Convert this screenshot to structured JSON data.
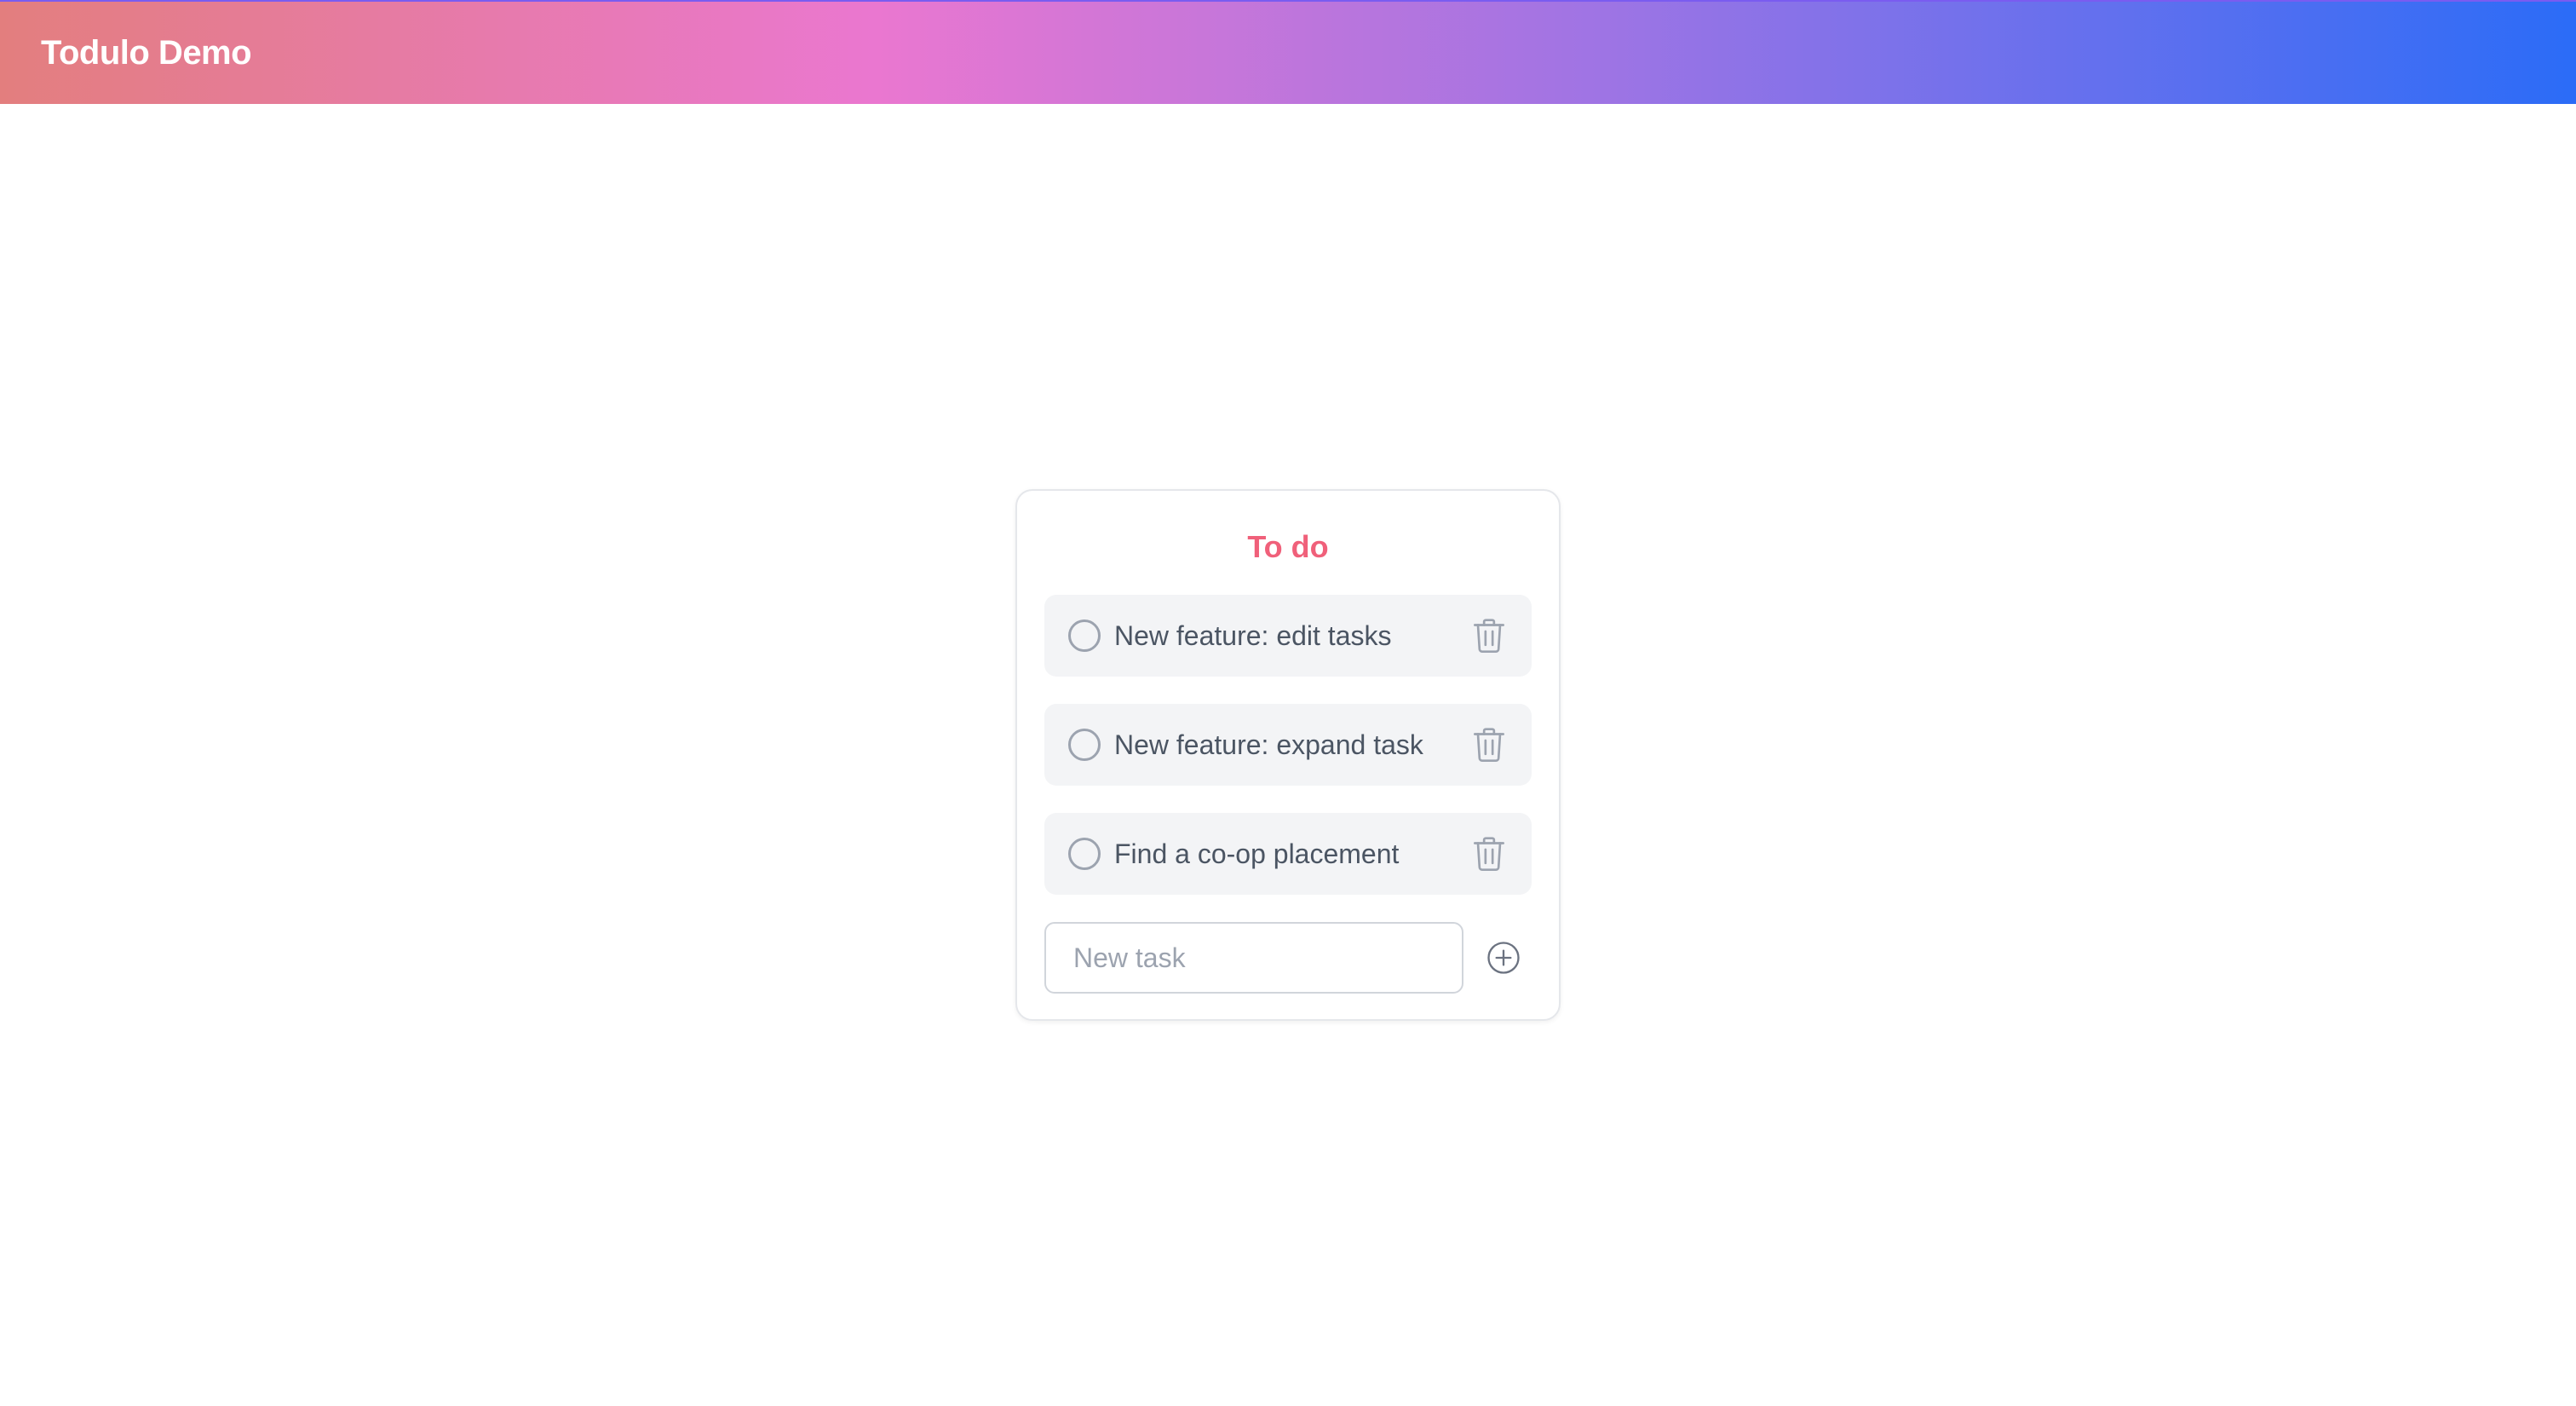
{
  "header": {
    "title": "Todulo Demo",
    "gradient_colors": [
      "#e37e7e",
      "#ea77d0",
      "#9f74e4",
      "#2b6cf7"
    ]
  },
  "card": {
    "title": "To do",
    "title_color": "#f0607a"
  },
  "tasks": [
    {
      "label": "New feature: edit tasks",
      "completed": false
    },
    {
      "label": "New feature: expand task",
      "completed": false
    },
    {
      "label": "Find a co-op placement",
      "completed": false
    }
  ],
  "new_task": {
    "placeholder": "New task",
    "value": ""
  },
  "icons": {
    "checkbox": "circle-checkbox-icon",
    "delete": "trash-icon",
    "add": "plus-circle-icon"
  }
}
